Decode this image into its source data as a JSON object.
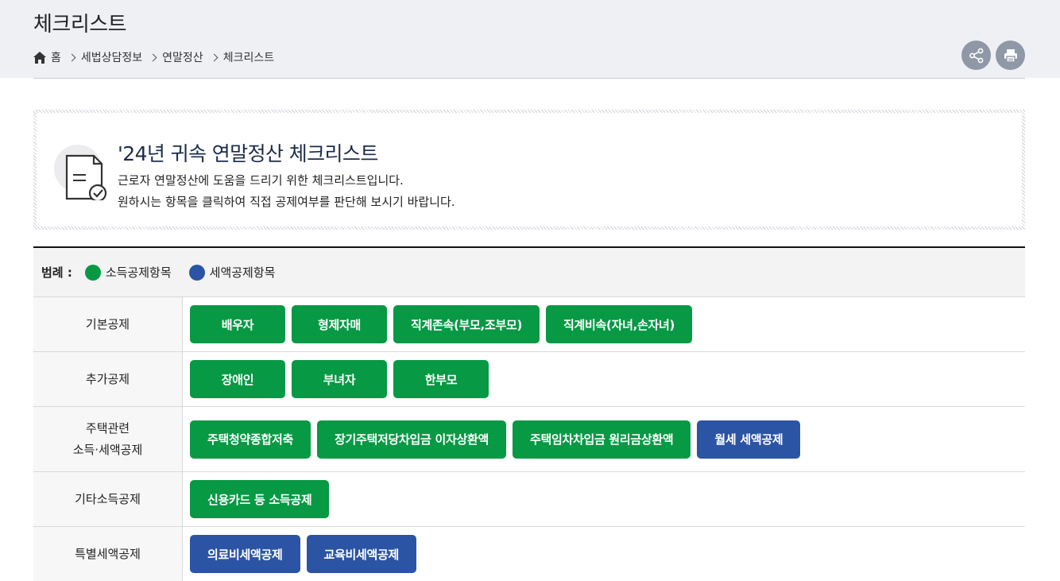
{
  "header": {
    "title": "체크리스트",
    "breadcrumb": [
      "홈",
      "세법상담정보",
      "연말정산",
      "체크리스트"
    ]
  },
  "icons": {
    "home": "home-icon",
    "share": "share-icon",
    "print": "print-icon",
    "document": "document-check-icon"
  },
  "intro": {
    "title": "'24년 귀속 연말정산 체크리스트",
    "line1": "근로자 연말정산에 도움을 드리기 위한 체크리스트입니다.",
    "line2": "원하시는 항목을 클릭하여 직접 공제여부를 판단해 보시기 바랍니다."
  },
  "legend": {
    "title": "범례 :",
    "income": "소득공제항목",
    "tax": "세액공제항목"
  },
  "colors": {
    "income_deduction": "#079944",
    "tax_credit": "#2c54a4"
  },
  "rows": [
    {
      "label": "기본공제",
      "buttons": [
        {
          "text": "배우자",
          "type": "income"
        },
        {
          "text": "형제자매",
          "type": "income"
        },
        {
          "text": "직계존속(부모,조부모)",
          "type": "income"
        },
        {
          "text": "직계비속(자녀,손자녀)",
          "type": "income"
        }
      ]
    },
    {
      "label": "추가공제",
      "buttons": [
        {
          "text": "장애인",
          "type": "income"
        },
        {
          "text": "부녀자",
          "type": "income"
        },
        {
          "text": "한부모",
          "type": "income"
        }
      ]
    },
    {
      "label_line1": "주택관련",
      "label_line2": "소득·세액공제",
      "buttons": [
        {
          "text": "주택청약종합저축",
          "type": "income"
        },
        {
          "text": "장기주택저당차입금 이자상환액",
          "type": "income"
        },
        {
          "text": "주택임차차입금 원리금상환액",
          "type": "income"
        },
        {
          "text": "월세 세액공제",
          "type": "tax"
        }
      ]
    },
    {
      "label": "기타소득공제",
      "buttons": [
        {
          "text": "신용카드 등 소득공제",
          "type": "income"
        }
      ]
    },
    {
      "label": "특별세액공제",
      "buttons": [
        {
          "text": "의료비세액공제",
          "type": "tax"
        },
        {
          "text": "교육비세액공제",
          "type": "tax"
        }
      ]
    }
  ]
}
